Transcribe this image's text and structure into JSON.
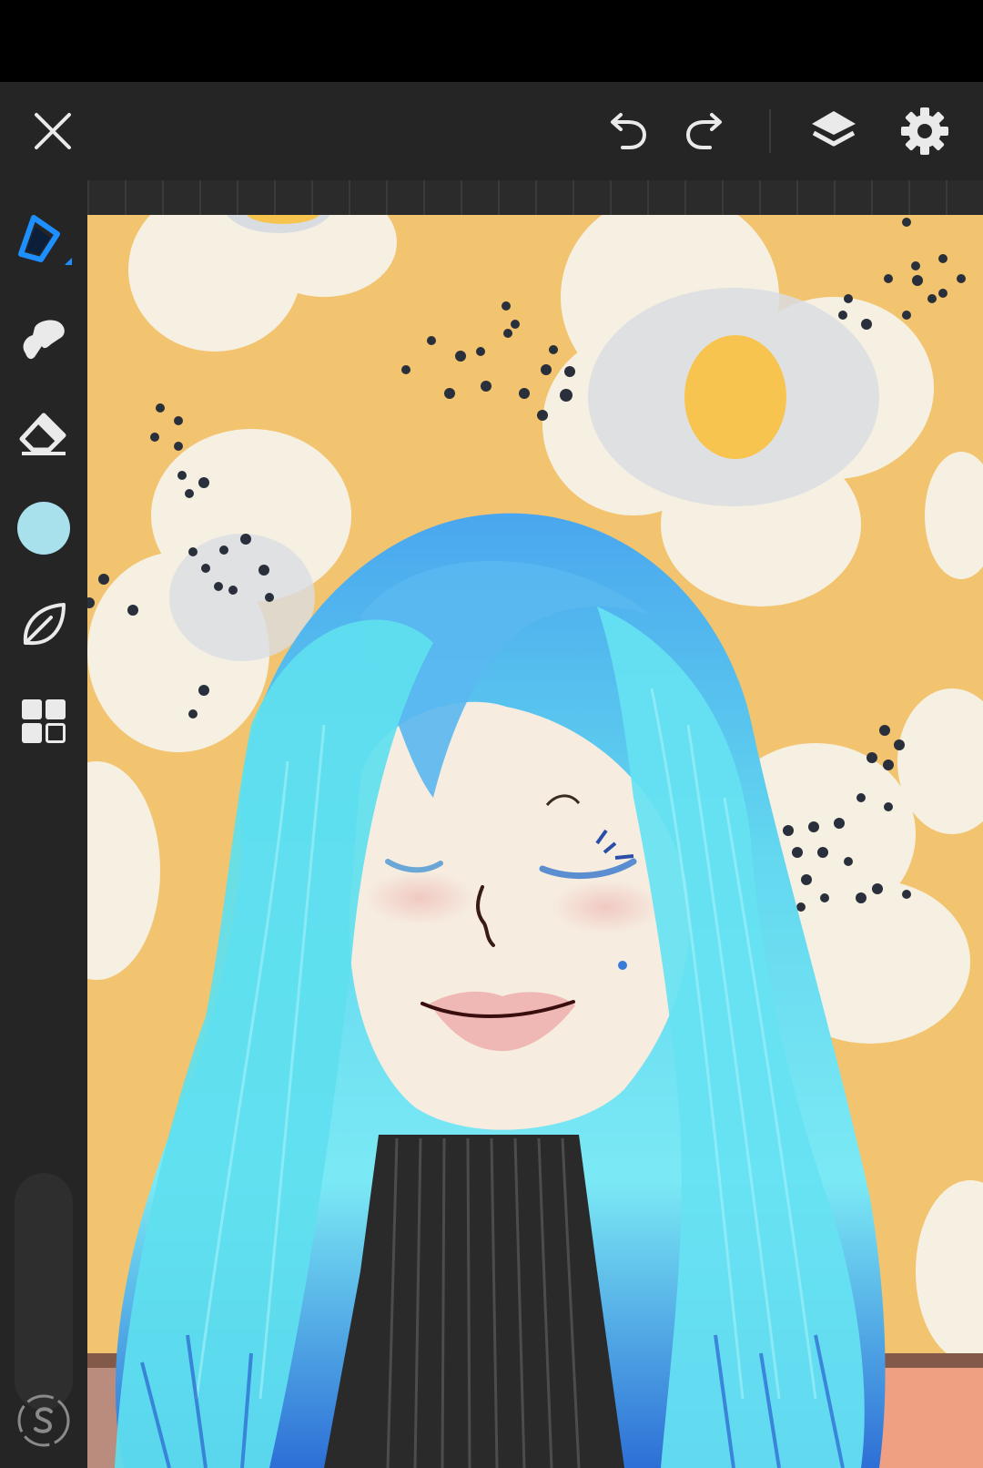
{
  "toolbar": {
    "icons": [
      "close-icon",
      "undo-icon",
      "redo-icon",
      "layers-icon",
      "settings-icon"
    ]
  },
  "tools": {
    "icons": [
      "brush-icon",
      "smudge-icon",
      "eraser-icon",
      "color-swatch",
      "leaf-icon",
      "grid-icon",
      "stabilizer-icon"
    ],
    "current_color": "#a8e0ec",
    "accent": "#1e8fff"
  },
  "canvas": {
    "background_color": "#f3c46f"
  }
}
